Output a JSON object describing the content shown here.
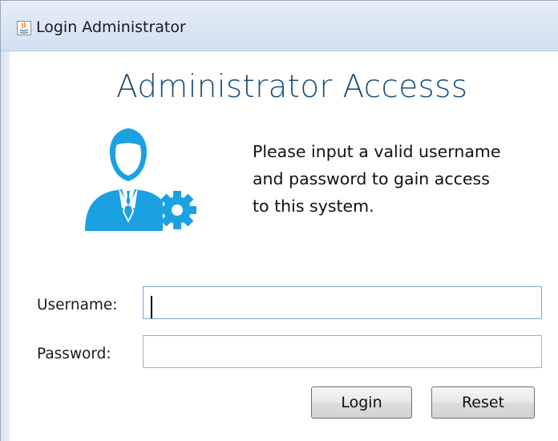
{
  "window": {
    "title": "Login Administrator"
  },
  "main": {
    "heading": "Administrator Accesss",
    "instructions": [
      "Please input a valid username",
      "and password to gain access",
      "to this system."
    ],
    "icon": "admin-user-gear-icon",
    "accent_color": "#1ba1e2"
  },
  "form": {
    "username_label": "Username:",
    "username_value": "",
    "password_label": "Password:",
    "password_value": "",
    "login_label": "Login",
    "reset_label": "Reset"
  }
}
